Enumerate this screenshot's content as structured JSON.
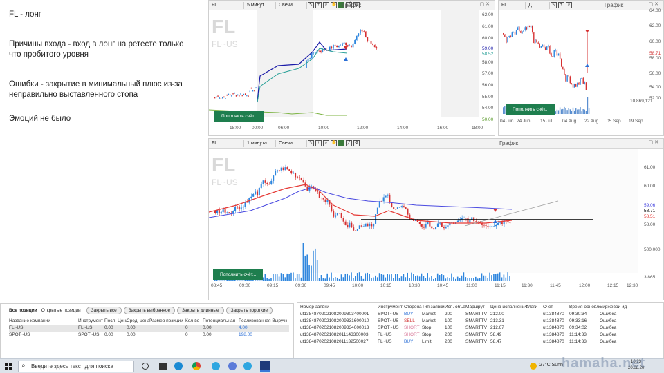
{
  "notes": {
    "title": "FL - лонг",
    "reason": "Причины входа - вход в лонг на ретесте только что пробитого уровня",
    "errors": "Ошибки - закрытие в минимальный плюс из-за неправильно выставленного стопа",
    "emotions": "Эмоций не было"
  },
  "top_chart": {
    "symbol": "FL",
    "interval": "5 минут",
    "type": "Свечи",
    "title": "График",
    "ticker_big": "FL",
    "ticker_sub": "FL~US",
    "fund_label": "Пополнить счёт...",
    "y_ticks": [
      "62.00",
      "61.00",
      "60.00",
      "59.00",
      "58.52",
      "58.00",
      "57.00",
      "56.00",
      "55.00",
      "54.00",
      "50.00"
    ],
    "x_ticks": [
      "18:00",
      "00:00",
      "06:00",
      "10:00",
      "12:00",
      "14:00",
      "16:00",
      "18:00"
    ]
  },
  "right_chart": {
    "symbol": "FL",
    "interval": "Д",
    "title": "График",
    "y_ticks": [
      "64.00",
      "62.00",
      "60.00",
      "58.71",
      "58.00",
      "56.00",
      "54.00",
      "52.00"
    ],
    "volume_label": "10,869,121",
    "x_ticks": [
      "04 Jun",
      "24 Jun",
      "15 Jul",
      "04 Aug",
      "22 Aug",
      "05 Sep",
      "19 Sep"
    ],
    "fund_label": "Пополнить счёт..."
  },
  "main_chart": {
    "symbol": "FL",
    "interval": "1 минута",
    "type": "Свечи",
    "title": "График",
    "ticker_big": "FL",
    "ticker_sub": "FL~US",
    "fund_label": "Пополнить счёт...",
    "y_ticks": [
      "61.00",
      "60.00",
      "59.06",
      "58.71",
      "58.51",
      "58.00"
    ],
    "volume_ticks": [
      "500,000",
      "3,865"
    ],
    "x_ticks": [
      "08:45",
      "09:00",
      "09:15",
      "09:30",
      "09:45",
      "10:00",
      "10:15",
      "10:30",
      "10:45",
      "11:00",
      "11:15",
      "11:30",
      "11:45",
      "12:00",
      "12:15",
      "12:30"
    ]
  },
  "positions": {
    "tab_all": "Все позиции",
    "tab_open": "Открытые позиции",
    "buttons": [
      "Закрыть все",
      "Закрыть выбранное",
      "Закрыть длинные",
      "Закрыть короткие"
    ],
    "headers": [
      "Название компании",
      "Инструмент",
      "Посл. Цена",
      "Сред. цена",
      "Размер позиции",
      "Кол-во",
      "Потенциальная",
      "Реализованная Выручка"
    ],
    "rows": [
      [
        "FL~US",
        "FL~US",
        "0.00",
        "0.00",
        "",
        "0",
        "0.00",
        "4.00"
      ],
      [
        "SPOT~US",
        "SPOT~US",
        "0.00",
        "0.00",
        "",
        "0",
        "0.00",
        "198.00"
      ]
    ]
  },
  "orders": {
    "headers": [
      "Номер заявки",
      "Инструмент",
      "Сторона",
      "Тип заявки",
      "Исп. объем",
      "Маршрут",
      "Цена исполнения",
      "Флаги",
      "Счет",
      "Время обновления",
      "Биржевой идентиф"
    ],
    "rows": [
      [
        "ut13848702021082009303400001",
        "SPOT~US",
        "BUY",
        "Market",
        "200",
        "SMARTTV",
        "212.00",
        "",
        "ut1384870",
        "09:30:34",
        "Ошибка"
      ],
      [
        "ut13848702021082009331600010",
        "SPOT~US",
        "SELL",
        "Market",
        "100",
        "SMARTTV",
        "213.31",
        "",
        "ut1384870",
        "09:33:16",
        "Ошибка"
      ],
      [
        "ut13848702021082009334000013",
        "SPOT~US",
        "SHORT",
        "Stop",
        "100",
        "SMARTTV",
        "212.67",
        "",
        "ut1384870",
        "09:34:02",
        "Ошибка"
      ],
      [
        "ut13848702021082011143300003",
        "FL~US",
        "SHORT",
        "Stop",
        "200",
        "SMARTTV",
        "58.49",
        "",
        "ut1384870",
        "11:14:33",
        "Ошибка"
      ],
      [
        "ut13848702021082011132500027",
        "FL~US",
        "BUY",
        "Limit",
        "200",
        "SMARTTV",
        "58.47",
        "",
        "ut1384870",
        "11:14:33",
        "Ошибка"
      ]
    ]
  },
  "taskbar": {
    "search_placeholder": "Введите здесь текст для поиска",
    "weather": "27°C Sunn",
    "time": "10:23",
    "date": "20.08.20"
  },
  "watermark": "hamaha.net",
  "colors": {
    "green_button": "#1e7e4e",
    "buy": "#2b6fd6",
    "sell": "#d23b3b",
    "candle_up": "#2e86de",
    "candle_down": "#d63031"
  }
}
